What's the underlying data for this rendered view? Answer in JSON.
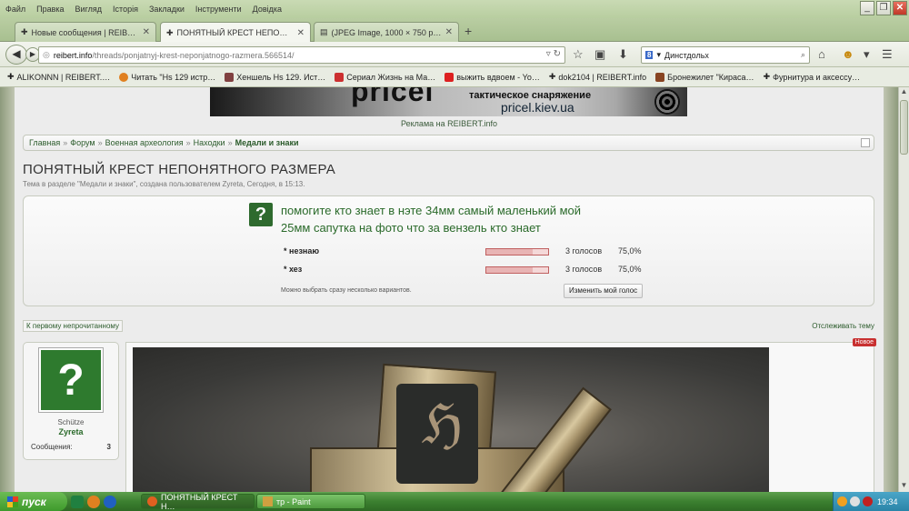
{
  "menubar": {
    "items": [
      "Файл",
      "Правка",
      "Вигляд",
      "Історія",
      "Закладки",
      "Інструменти",
      "Довідка"
    ]
  },
  "window_buttons": {
    "minimize": "_",
    "maximize": "❐",
    "close": "✕"
  },
  "tabs": [
    {
      "label": "Новые сообщения | REIBER…"
    },
    {
      "label": "ПОНЯТНЫЙ КРЕСТ НЕПОНЯТ…"
    },
    {
      "label": "(JPEG Image, 1000 × 750 pix…"
    }
  ],
  "nav": {
    "url_host": "reibert.info",
    "url_path": "/threads/ponjatnyj-krest-neponjatnogo-razmera.566514/",
    "search_engine_letter": "8",
    "search_value": "Динстдольх"
  },
  "bookmarks": [
    {
      "label": "ALIKONNN | REIBERT.…",
      "color": "#222"
    },
    {
      "label": "Читать \"Hs 129 истр…",
      "color": "#e08020"
    },
    {
      "label": "Хеншель Hs 129. Ист…",
      "color": "#804040"
    },
    {
      "label": "Сериал Жизнь на Ма…",
      "color": "#cc3030"
    },
    {
      "label": "выжить вдвоем - Yo…",
      "color": "#dd2020"
    },
    {
      "label": "dok2104 | REIBERT.info",
      "color": "#222"
    },
    {
      "label": "Бронежилет \"Кираса…",
      "color": "#884422"
    },
    {
      "label": "Фурнитура и аксессу…",
      "color": "#222"
    }
  ],
  "banner": {
    "brand": "pricel",
    "tagline": "тактическое снаряжение",
    "site": "pricel.kiev.ua"
  },
  "ad_text": "Реклама на REIBERT.info",
  "breadcrumb": {
    "items": [
      "Главная",
      "Форум",
      "Военная археология",
      "Находки"
    ],
    "current": "Медали и знаки",
    "separator": "»"
  },
  "thread": {
    "title": "ПОНЯТНЫЙ КРЕСТ НЕПОНЯТНОГО РАЗМЕРА",
    "meta": "Тема в разделе \"Медали и знаки\", создана пользователем Zyreta, Сегодня, в 15:13."
  },
  "poll": {
    "icon": "?",
    "question_line1": "помогите кто знает в нэте 34мм самый маленький мой",
    "question_line2": "25мм сапутка на фото что за вензель кто знает",
    "options": [
      {
        "label": "* незнаю",
        "votes": "3 голосов",
        "percent": "75,0%",
        "fraction": 0.75
      },
      {
        "label": "* хез",
        "votes": "3 голосов",
        "percent": "75,0%",
        "fraction": 0.75
      }
    ],
    "note": "Можно выбрать сразу несколько вариантов.",
    "change_vote": "Изменить мой голос"
  },
  "first_unread": "К первому непрочитанному",
  "follow_thread": "Отслеживать тему",
  "user": {
    "avatar": "?",
    "title": "Schütze",
    "name": "Zyreta",
    "messages_label": "Сообщения:",
    "messages_count": "3"
  },
  "post": {
    "new_badge": "Новое"
  },
  "taskbar": {
    "start": "пуск",
    "windows": [
      {
        "label": "ПОНЯТНЫЙ КРЕСТ Н…"
      },
      {
        "label": "тр - Paint"
      }
    ],
    "clock": "19:34"
  },
  "colors": {
    "accent_green": "#2a6a2a",
    "poll_bar": "#e8b4b4",
    "new_badge": "#c83030"
  }
}
